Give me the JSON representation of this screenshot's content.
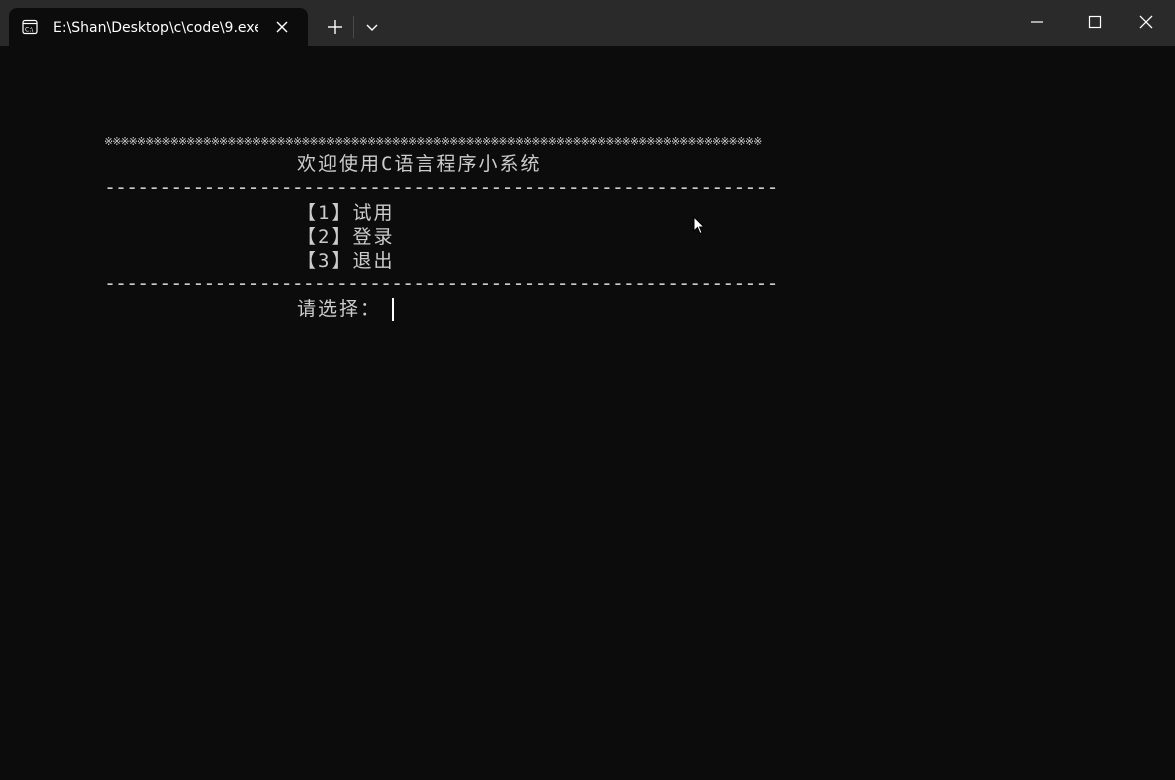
{
  "window": {
    "tab_title": "E:\\Shan\\Desktop\\c\\code\\9.exe",
    "tab_icon": "console-icon",
    "new_tab_icon": "plus-icon",
    "dropdown_icon": "chevron-down-icon",
    "minimize_icon": "minimize-icon",
    "maximize_icon": "maximize-icon",
    "close_icon": "close-icon"
  },
  "console": {
    "star_border": "※※※※※※※※※※※※※※※※※※※※※※※※※※※※※※※※※※※※※※※※※※※※※※※※※※※※※※※※※※※※※※※※※※※※※※※※※※※※※※※※",
    "title": "欢迎使用C语言程序小系统",
    "dash_border": "------------------------------------------------------------------------",
    "menu": [
      "【1】试用",
      "【2】登录",
      "【3】退出"
    ],
    "prompt": "请选择："
  },
  "colors": {
    "background": "#0c0c0c",
    "titlebar": "#2a2a2a",
    "text": "#cccccc"
  }
}
